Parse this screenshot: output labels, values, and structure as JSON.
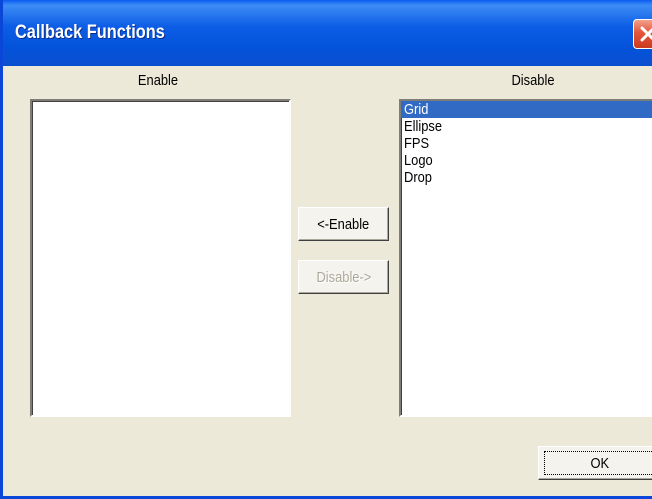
{
  "window": {
    "title": "Callback Functions"
  },
  "icons": {
    "close": "close-x-icon"
  },
  "enable_panel": {
    "label": "Enable",
    "items": []
  },
  "disable_panel": {
    "label": "Disable",
    "items": [
      {
        "label": "Grid",
        "selected": true
      },
      {
        "label": "Ellipse",
        "selected": false
      },
      {
        "label": "FPS",
        "selected": false
      },
      {
        "label": "Logo",
        "selected": false
      },
      {
        "label": "Drop",
        "selected": false
      }
    ]
  },
  "buttons": {
    "enable_label": "<-Enable",
    "disable_label": "Disable->",
    "disable_enabled": false,
    "ok_label": "OK"
  },
  "colors": {
    "titlebar": "#0a5bf2",
    "selection": "#316ac5",
    "close": "#e5563b"
  }
}
